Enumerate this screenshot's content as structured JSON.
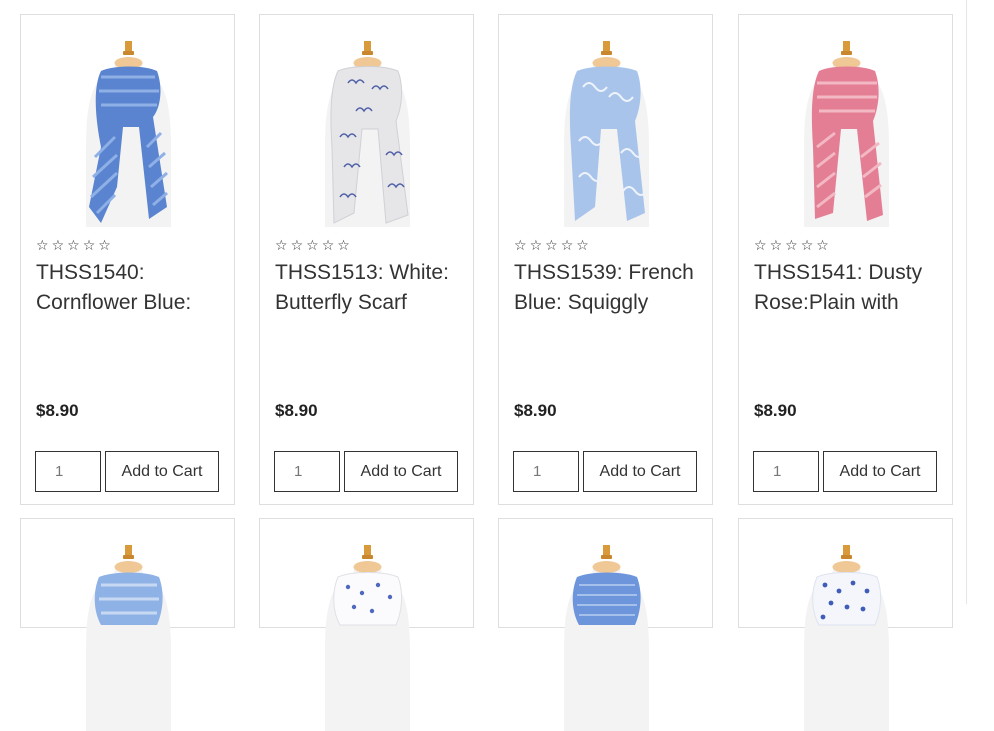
{
  "products": [
    {
      "title": "THSS1540: Cornflower Blue:",
      "price": "$8.90",
      "qty": "1",
      "add_label": "Add to Cart",
      "rating": 0,
      "color": "#5a84cf",
      "pattern": "stripes"
    },
    {
      "title": "THSS1513: White: Butterfly Scarf",
      "price": "$8.90",
      "qty": "1",
      "add_label": "Add to Cart",
      "rating": 0,
      "color": "#e8e8ea",
      "pattern": "butterfly"
    },
    {
      "title": "THSS1539: French Blue: Squiggly",
      "price": "$8.90",
      "qty": "1",
      "add_label": "Add to Cart",
      "rating": 0,
      "color": "#a9c4ea",
      "pattern": "squiggle"
    },
    {
      "title": "THSS1541: Dusty Rose:Plain with",
      "price": "$8.90",
      "qty": "1",
      "add_label": "Add to Cart",
      "rating": 0,
      "color": "#e47e95",
      "pattern": "stripes"
    }
  ],
  "next_row": [
    {
      "color": "#8fb2e6"
    },
    {
      "color": "#ffffff"
    },
    {
      "color": "#6d95dc"
    },
    {
      "color": "#f4f6fb"
    }
  ]
}
